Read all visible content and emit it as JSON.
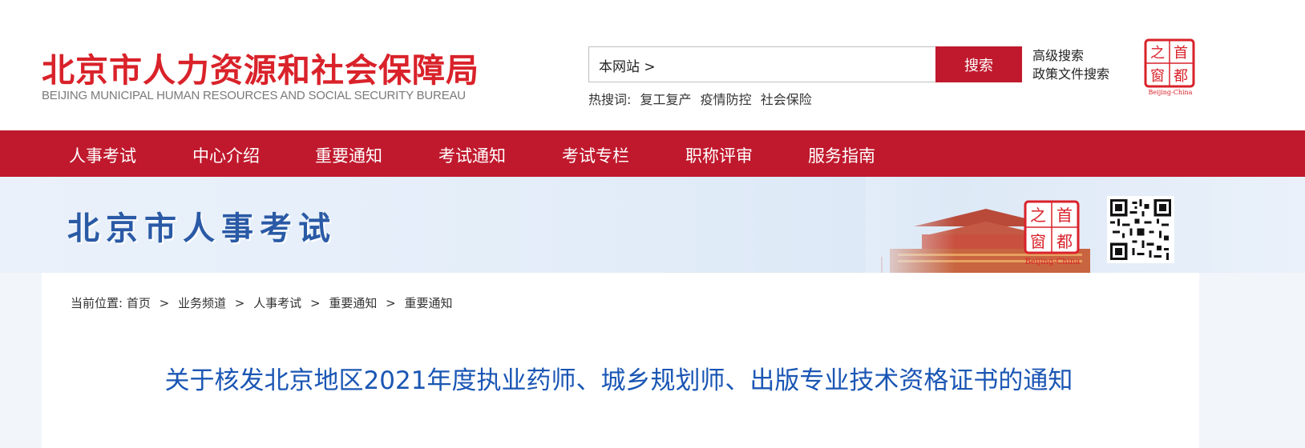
{
  "header": {
    "logo_cn": "北京市人力资源和社会保障局",
    "logo_en": "BEIJING MUNICIPAL HUMAN RESOURCES AND SOCIAL SECURITY BUREAU",
    "capital_logo_chars": [
      "首",
      "都",
      "之",
      "窗"
    ],
    "capital_logo_en": "Beijing-China"
  },
  "search": {
    "scope": "本网站 >",
    "placeholder": "",
    "button": "搜索",
    "advanced": "高级搜索",
    "policy": "政策文件搜索",
    "hot_label": "热搜词:",
    "hot_words": [
      "复工复产",
      "疫情防控",
      "社会保险"
    ]
  },
  "nav": {
    "items": [
      "人事考试",
      "中心介绍",
      "重要通知",
      "考试通知",
      "考试专栏",
      "职称评审",
      "服务指南"
    ]
  },
  "banner": {
    "title": "北京市人事考试"
  },
  "breadcrumb": {
    "label": "当前位置:",
    "items": [
      "首页",
      "业务频道",
      "人事考试",
      "重要通知",
      "重要通知"
    ],
    "separator": ">"
  },
  "article": {
    "title": "关于核发北京地区2021年度执业药师、城乡规划师、出版专业技术资格证书的通知"
  },
  "colors": {
    "brand_red": "#c0192d",
    "logo_red": "#d9222a",
    "title_blue": "#1a56b4",
    "banner_blue": "#2a5aa6"
  }
}
